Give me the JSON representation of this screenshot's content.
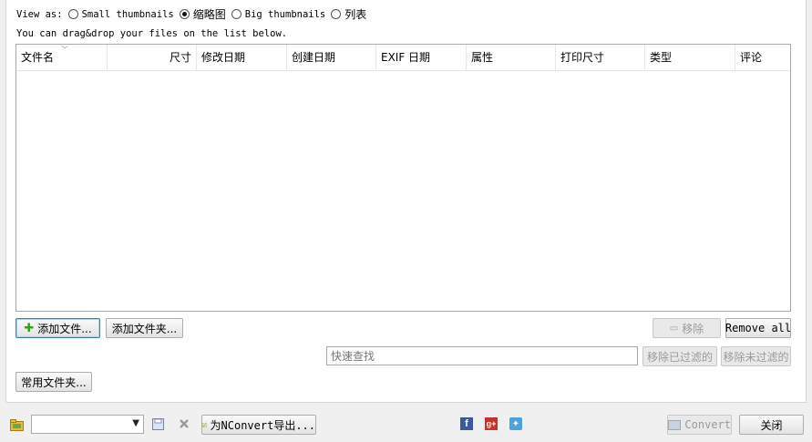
{
  "view_as": {
    "label": "View as:",
    "options": [
      {
        "label": "Small thumbnails",
        "selected": false
      },
      {
        "label": "缩略图",
        "selected": true
      },
      {
        "label": "Big thumbnails",
        "selected": false
      },
      {
        "label": "列表",
        "selected": false
      }
    ]
  },
  "hint": "You can drag&drop your files on the list below.",
  "columns": [
    "文件名",
    "尺寸",
    "修改日期",
    "创建日期",
    "EXIF 日期",
    "属性",
    "打印尺寸",
    "类型",
    "评论"
  ],
  "buttons": {
    "add_files": "添加文件...",
    "add_folder": "添加文件夹...",
    "remove": "移除",
    "remove_all": "Remove all",
    "remove_filtered": "移除已过滤的",
    "remove_unfiltered": "移除未过滤的",
    "common_folders": "常用文件夹...",
    "export_nconvert": "为NConvert导出...",
    "convert": "Convert",
    "close": "关闭"
  },
  "search": {
    "placeholder": "快速查找",
    "value": ""
  },
  "preset_combo": {
    "value": ""
  },
  "icons": {
    "folder": "folder-icon",
    "plus": "plus-icon",
    "save": "save-icon",
    "delete": "delete-icon",
    "script": "script-icon",
    "facebook": "facebook-icon",
    "googleplus": "googleplus-icon",
    "twitter": "twitter-icon"
  }
}
